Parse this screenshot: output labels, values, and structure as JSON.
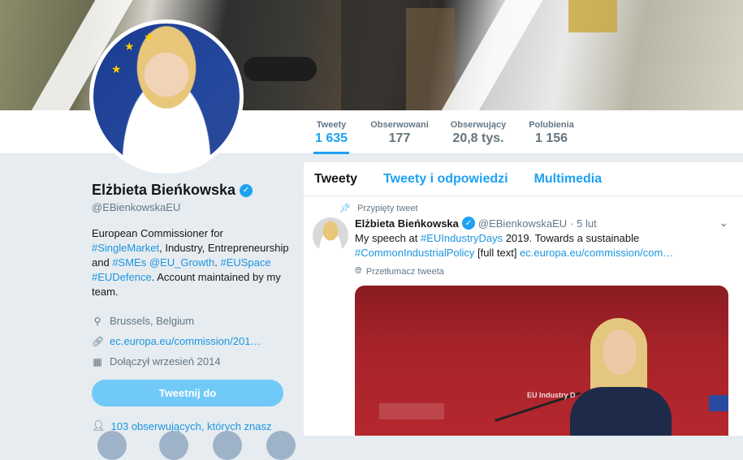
{
  "profile": {
    "name": "Elżbieta Bieńkowska",
    "handle": "@EBienkowskaEU",
    "bio_parts": {
      "p1": "European Commissioner for ",
      "single_market": "#SingleMarket",
      "p2": ", Industry, Entrepreneurship and ",
      "smes": "#SMEs",
      "growth": "@EU_Growth",
      "p3": ". ",
      "space": "#EUSpace",
      "defence": "#EUDefence",
      "p4": ". Account maintained by my team."
    },
    "location": "Brussels, Belgium",
    "website": "ec.europa.eu/commission/201…",
    "joined": "Dołączył wrzesień 2014",
    "tweet_to_label": "Tweetnij do",
    "followers_you_know": "103 obserwujących, których znasz"
  },
  "stats": [
    {
      "label": "Tweety",
      "value": "1 635"
    },
    {
      "label": "Obserwowani",
      "value": "177"
    },
    {
      "label": "Obserwujący",
      "value": "20,8 tys."
    },
    {
      "label": "Polubienia",
      "value": "1 156"
    }
  ],
  "tabs": [
    "Tweety",
    "Tweety i odpowiedzi",
    "Multimedia"
  ],
  "tweet": {
    "pinned_label": "Przypięty tweet",
    "author_name": "Elżbieta Bieńkowska",
    "author_handle": "@EBienkowskaEU",
    "date": "· 5 lut",
    "text_p1": "My speech at ",
    "tag1": "#EUIndustryDays",
    "text_p2": " 2019. Towards a sustainable ",
    "tag2": "#CommonIndustrialPolicy",
    "text_p3": " [full text] ",
    "link": "ec.europa.eu/commission/com…",
    "translate": "Przetłumacz tweeta",
    "media_text": "EU Industry D"
  },
  "colors": {
    "accent": "#1da1f2",
    "link": "#1b95e0",
    "background": "#e6ecf0"
  }
}
